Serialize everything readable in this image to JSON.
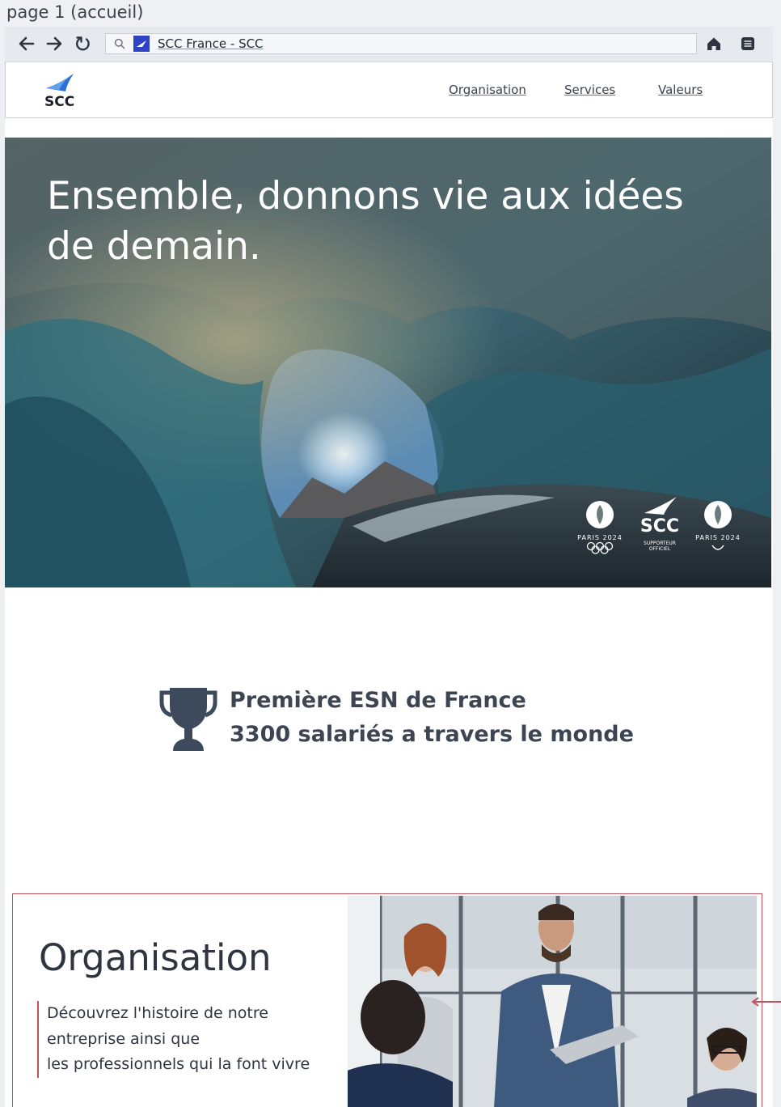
{
  "caption": "page 1 (accueil)",
  "browser": {
    "tab_title": "SCC France - SCC",
    "back_icon": "arrow-left-icon",
    "forward_icon": "arrow-right-icon",
    "reload_icon": "reload-icon",
    "home_icon": "home-icon",
    "menu_icon": "menu-icon"
  },
  "header": {
    "logo_text": "SCC",
    "nav": [
      {
        "label": "Organisation"
      },
      {
        "label": "Services"
      },
      {
        "label": "Valeurs"
      }
    ]
  },
  "hero": {
    "title": "Ensemble, donnons vie aux idées de demain.",
    "partners": {
      "paris_left": "PARIS 2024",
      "scc": "SCC",
      "supporter_line1": "SUPPORTEUR",
      "supporter_line2": "OFFICIEL",
      "paris_right": "PARIS 2024"
    }
  },
  "stats": {
    "line1": "Première ESN de France",
    "line2": "3300 salariés a travers le monde"
  },
  "organisation": {
    "title": "Organisation",
    "desc_line1": "Découvrez l'histoire de notre",
    "desc_line2": "entreprise ainsi que",
    "desc_line3": "les professionnels qui la font vivre"
  },
  "colors": {
    "accent": "#c2525e",
    "favicon": "#2f43c6",
    "logo_blue": "#2e6fd6",
    "text_dark": "#2e3440"
  }
}
